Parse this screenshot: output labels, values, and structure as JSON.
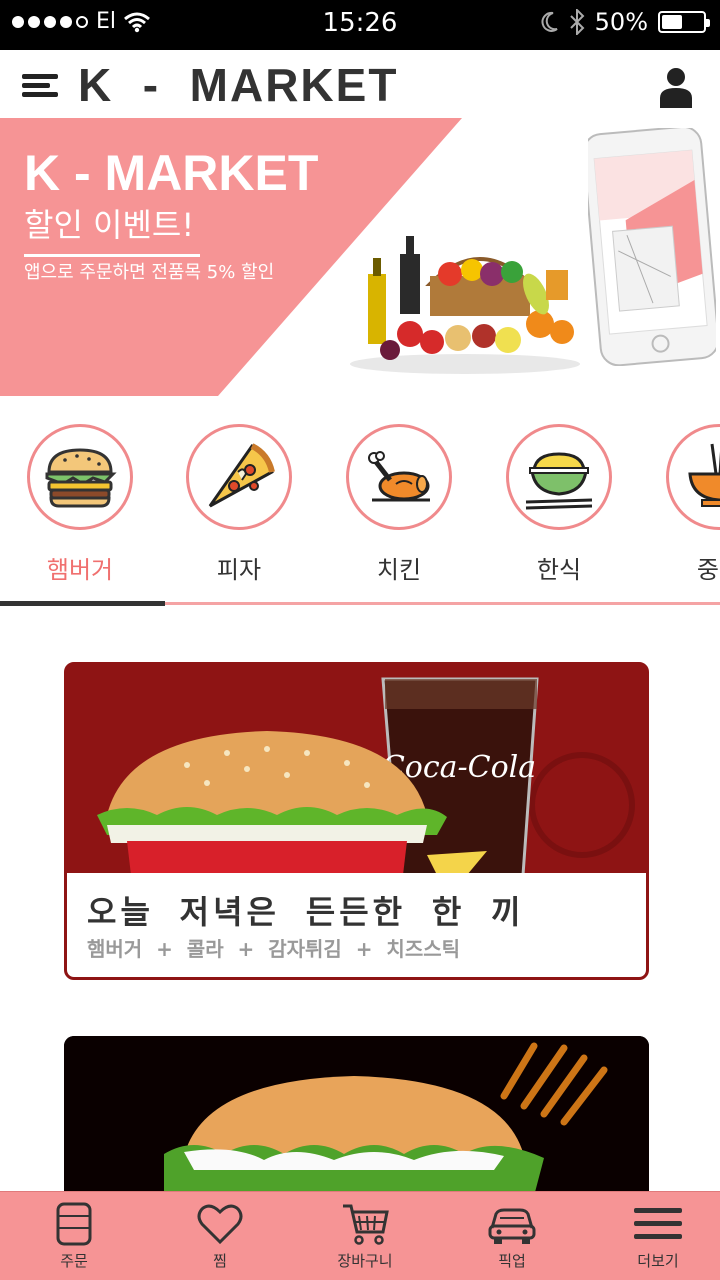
{
  "status_bar": {
    "carrier": "El",
    "time": "15:26",
    "battery": "50%",
    "battery_level": 0.5
  },
  "header": {
    "title": "K  -  MARKET",
    "menu_icon": "hamburger-menu-icon",
    "user_icon": "user-icon"
  },
  "banner": {
    "title": "K - MARKET",
    "subtitle": "할인 이벤트!",
    "description": "앱으로 주문하면 전품목 5% 할인",
    "colors": {
      "accent": "#f69495"
    }
  },
  "categories": {
    "items": [
      {
        "label": "햄버거",
        "icon": "burger-icon",
        "active": true
      },
      {
        "label": "피자",
        "icon": "pizza-icon",
        "active": false
      },
      {
        "label": "치킨",
        "icon": "chicken-icon",
        "active": false
      },
      {
        "label": "한식",
        "icon": "rice-bowl-icon",
        "active": false
      },
      {
        "label": "중식",
        "icon": "noodle-bowl-icon",
        "active": false
      }
    ]
  },
  "cards": [
    {
      "title": "오늘  저녁은  든든한  한  끼",
      "items": "햄버거  +  콜라  +  감자튀김  +  치즈스틱"
    }
  ],
  "tab_bar": {
    "items": [
      {
        "label": "주문",
        "icon": "order-icon"
      },
      {
        "label": "찜",
        "icon": "heart-icon"
      },
      {
        "label": "장바구니",
        "icon": "cart-icon"
      },
      {
        "label": "픽업",
        "icon": "car-icon"
      },
      {
        "label": "더보기",
        "icon": "more-menu-icon"
      }
    ]
  }
}
